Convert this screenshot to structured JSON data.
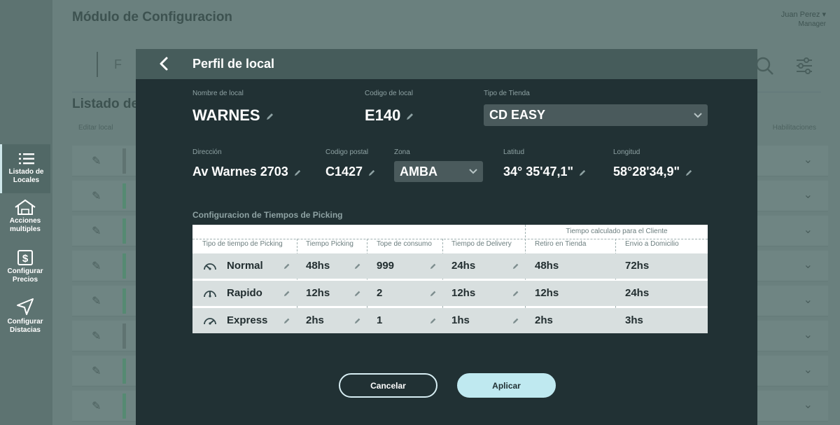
{
  "app": {
    "title": "Módulo de Configuracion",
    "user_name": "Juan Perez",
    "user_role": "Manager",
    "search_placeholder": "F",
    "list_title": "Listado de",
    "list_col_left": "Editar local",
    "list_col_right": "Habilitaciones"
  },
  "sidebar": {
    "items": [
      {
        "label_1": "Listado de",
        "label_2": "Locales",
        "icon": "list-icon",
        "active": true
      },
      {
        "label_1": "Acciones",
        "label_2": "multiples",
        "icon": "home-icon",
        "active": false
      },
      {
        "label_1": "Configurar",
        "label_2": "Precios",
        "icon": "dollar-icon",
        "active": false
      },
      {
        "label_1": "Configurar",
        "label_2": "Distacias",
        "icon": "send-icon",
        "active": false
      }
    ]
  },
  "modal": {
    "title": "Perfil de local",
    "fields": {
      "nombre": {
        "label": "Nombre de local",
        "value": "WARNES"
      },
      "codigo": {
        "label": "Codigo de local",
        "value": "E140"
      },
      "tipo": {
        "label": "Tipo de Tienda",
        "value": "CD EASY"
      },
      "direccion": {
        "label": "Dirección",
        "value": "Av Warnes 2703"
      },
      "postal": {
        "label": "Codigo postal",
        "value": "C1427"
      },
      "zona": {
        "label": "Zona",
        "value": "AMBA"
      },
      "latitud": {
        "label": "Latitud",
        "value": "34° 35'47,1\""
      },
      "longitud": {
        "label": "Longitud",
        "value": "58°28'34,9\""
      }
    },
    "section_title": "Configuracion de Tiempos de Picking",
    "table": {
      "group_header": "Tiempo calculado para el Cliente",
      "headers": [
        "Tipo de tiempo de Picking",
        "Tiempo Picking",
        "Tope de consumo",
        "Tiempo de Delivery",
        "Retiro en Tienda",
        "Envio a Domicilio"
      ],
      "rows": [
        {
          "icon": "speedometer-slow-icon",
          "tipo": "Normal",
          "picking": "48hs",
          "tope": "999",
          "delivery": "24hs",
          "retiro": "48hs",
          "envio": "72hs"
        },
        {
          "icon": "speedometer-mid-icon",
          "tipo": "Rapido",
          "picking": "12hs",
          "tope": "2",
          "delivery": "12hs",
          "retiro": "12hs",
          "envio": "24hs"
        },
        {
          "icon": "speedometer-fast-icon",
          "tipo": "Express",
          "picking": "2hs",
          "tope": "1",
          "delivery": "1hs",
          "retiro": "2hs",
          "envio": "3hs"
        }
      ]
    },
    "buttons": {
      "cancel": "Cancelar",
      "apply": "Aplicar"
    }
  },
  "colors": {
    "modal_bg": "#213134",
    "header_bg": "#465c5b",
    "accent": "#bfe9f0",
    "overlay": "#6a807e"
  }
}
